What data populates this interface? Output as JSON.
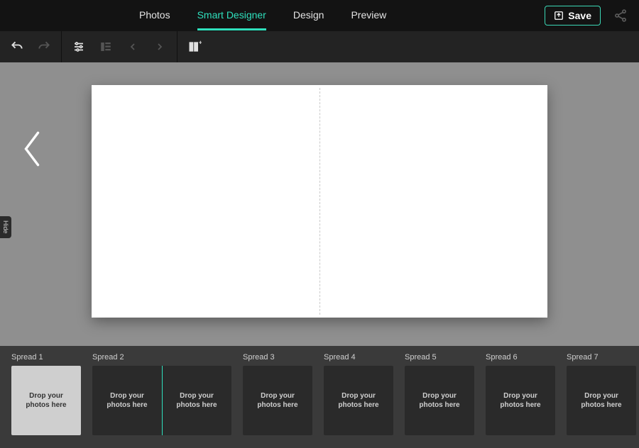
{
  "tabs": {
    "photos": "Photos",
    "smart_designer": "Smart Designer",
    "design": "Design",
    "preview": "Preview",
    "active": "smart_designer"
  },
  "top_actions": {
    "save_label": "Save"
  },
  "toolbar": {
    "undo": "undo",
    "redo": "redo",
    "sliders": "adjust",
    "layout_list": "layout-list",
    "prev": "previous",
    "next": "next",
    "add_page": "add-page"
  },
  "sidebar": {
    "hide_label": "Hide"
  },
  "canvas": {
    "current_spread": 2
  },
  "strip": {
    "spreads": [
      {
        "label": "Spread 1",
        "type": "single",
        "cover": true,
        "placeholder": "Drop your\nphotos here"
      },
      {
        "label": "Spread 2",
        "type": "double",
        "placeholder": "Drop your\nphotos here",
        "active": true
      },
      {
        "label": "Spread 3",
        "type": "single",
        "placeholder": "Drop your\nphotos here"
      },
      {
        "label": "Spread 4",
        "type": "single",
        "placeholder": "Drop your\nphotos here"
      },
      {
        "label": "Spread 5",
        "type": "single",
        "placeholder": "Drop your\nphotos here"
      },
      {
        "label": "Spread 6",
        "type": "single",
        "placeholder": "Drop your\nphotos here"
      },
      {
        "label": "Spread 7",
        "type": "single",
        "placeholder": "Drop your\nphotos here"
      }
    ]
  }
}
